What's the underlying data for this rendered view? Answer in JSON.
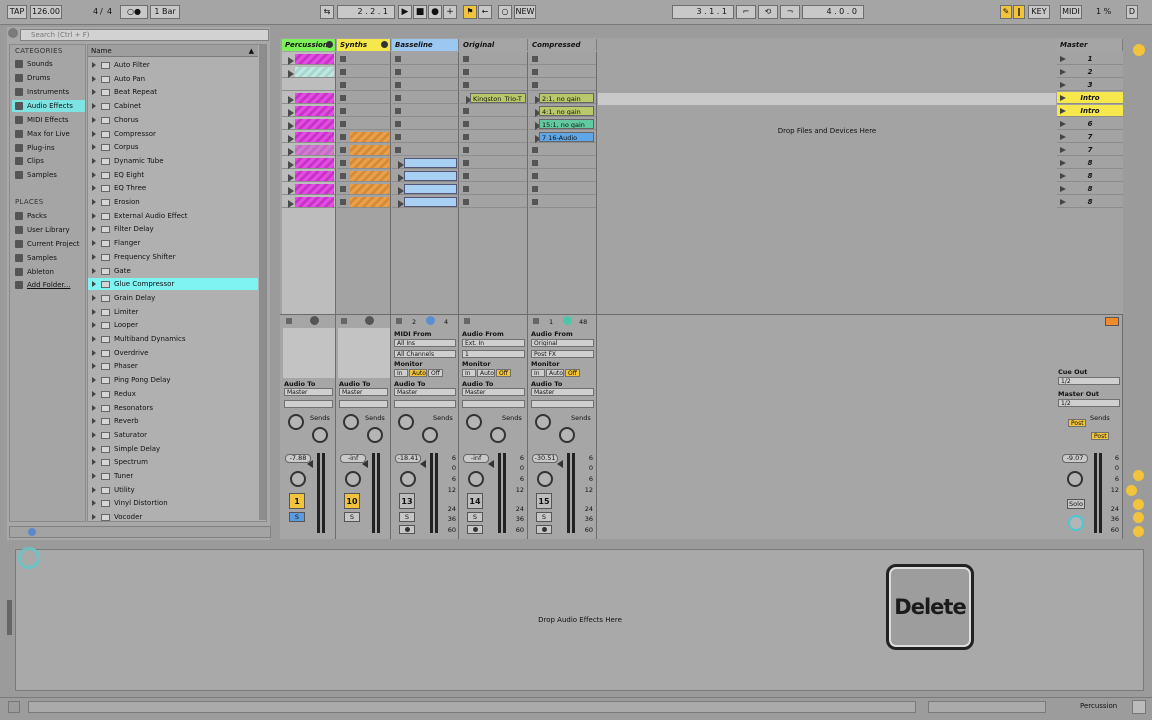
{
  "transport": {
    "tap": "TAP",
    "tempo": "126.00",
    "meter_num": "4",
    "meter_den": "4",
    "metro": "○●",
    "quantize": "1 Bar",
    "position": [
      "2",
      "2",
      "1"
    ],
    "new_label": "NEW",
    "loop_start": [
      "3",
      "1",
      "1"
    ],
    "loop_len": [
      "4",
      "0",
      "0"
    ],
    "key": "KEY",
    "midi": "MIDI",
    "cpu": "1 %",
    "d": "D"
  },
  "browser": {
    "search_placeholder": "Search (Ctrl + F)",
    "categories_title": "CATEGORIES",
    "categories": [
      "Sounds",
      "Drums",
      "Instruments",
      "Audio Effects",
      "MIDI Effects",
      "Max for Live",
      "Plug-ins",
      "Clips",
      "Samples"
    ],
    "selected_category": "Audio Effects",
    "places_title": "PLACES",
    "places": [
      "Packs",
      "User Library",
      "Current Project",
      "Samples",
      "Ableton",
      "Add Folder..."
    ],
    "name_header": "Name",
    "items": [
      "Auto Filter",
      "Auto Pan",
      "Beat Repeat",
      "Cabinet",
      "Chorus",
      "Compressor",
      "Corpus",
      "Dynamic Tube",
      "EQ Eight",
      "EQ Three",
      "Erosion",
      "External Audio Effect",
      "Filter Delay",
      "Flanger",
      "Frequency Shifter",
      "Gate",
      "Glue Compressor",
      "Grain Delay",
      "Limiter",
      "Looper",
      "Multiband Dynamics",
      "Overdrive",
      "Phaser",
      "Ping Pong Delay",
      "Redux",
      "Resonators",
      "Reverb",
      "Saturator",
      "Simple Delay",
      "Spectrum",
      "Tuner",
      "Utility",
      "Vinyl Distortion",
      "Vocoder"
    ],
    "selected_item": "Glue Compressor"
  },
  "tracks": [
    {
      "name": "Percussion",
      "color": "#7df15a",
      "number": "1"
    },
    {
      "name": "Synths",
      "color": "#f5e74c",
      "number": "10"
    },
    {
      "name": "Basseline",
      "color": "#9cc7f0",
      "number": "13"
    },
    {
      "name": "Original",
      "color": "#a5a5a5",
      "number": "14"
    },
    {
      "name": "Compressed",
      "color": "#a5a5a5",
      "number": "15"
    }
  ],
  "master": {
    "name": "Master",
    "volume": "-9.07"
  },
  "clips": {
    "original": "Kingston_Trio-T",
    "compressed": [
      "2:1, no gain",
      "4:1, no gain",
      "15:1, no gain",
      "7 16-Audio"
    ]
  },
  "drop_files": "Drop Files and Devices Here",
  "scenes": [
    "1",
    "2",
    "3",
    "Intro",
    "Intro",
    "6",
    "7",
    "7",
    "8",
    "8",
    "8",
    "8"
  ],
  "mixer": {
    "audio_to": "Audio To",
    "master_opt": "Master",
    "sends": "Sends",
    "midi_from": "MIDI From",
    "audio_from": "Audio From",
    "all_ins": "All Ins",
    "all_channels": "All Channels",
    "ext_in": "Ext. In",
    "ext_ch": "1",
    "orig_opt": "Original",
    "post_fx": "Post FX",
    "monitor": "Monitor",
    "mon_in": "In",
    "mon_auto": "Auto",
    "mon_off": "Off",
    "basseline_counts": [
      "2",
      "4"
    ],
    "compressed_counts": [
      "1",
      "48"
    ],
    "volumes": [
      "-7.88",
      "-inf",
      "-18.41",
      "-inf",
      "-30.51"
    ],
    "cue_out": "Cue Out",
    "cue_val": "1/2",
    "master_out": "Master Out",
    "master_val": "1/2",
    "post": "Post",
    "scale": [
      "6",
      "0",
      "6",
      "12",
      "24",
      "36",
      "60"
    ],
    "s": "S",
    "solo": "Solo"
  },
  "detail": {
    "drop_audio": "Drop Audio Effects Here",
    "delete_overlay": "Delete"
  },
  "status": {
    "track_name": "Percussion"
  }
}
